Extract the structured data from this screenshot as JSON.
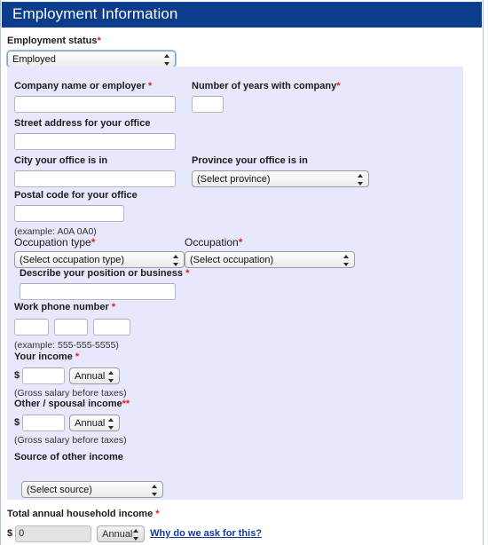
{
  "header": {
    "title": "Employment Information",
    "bar_color": "#0b3d8c"
  },
  "theme": {
    "panel_color": "#e7e8fb",
    "required_marker_color": "#e32119",
    "link_color": "#12399b"
  },
  "employment_status": {
    "label": "Employment status",
    "required_marker": "*",
    "selected": "Employed"
  },
  "fields": {
    "company_name": {
      "label": "Company name or employer",
      "required_marker": "*",
      "value": ""
    },
    "years_with_company": {
      "label": "Number of years with company",
      "required_marker": "*",
      "value": ""
    },
    "street_address": {
      "label": "Street address for your office",
      "value": ""
    },
    "city": {
      "label": "City your office is in",
      "value": ""
    },
    "province": {
      "label": "Province your office is in",
      "selected": "(Select province)"
    },
    "postal_code": {
      "label": "Postal code for your office",
      "value": "",
      "hint": "(example: A0A 0A0)"
    },
    "occupation_type": {
      "label": "Occupation type",
      "required_marker": "*",
      "selected": "(Select occupation type)"
    },
    "occupation": {
      "label": "Occupation",
      "required_marker": "*",
      "selected": "(Select occupation)"
    },
    "describe_position": {
      "label": "Describe your position or business",
      "required_marker": "*",
      "value": ""
    },
    "work_phone": {
      "label": "Work phone number",
      "required_marker": "*",
      "part1": "",
      "part2": "",
      "part3": "",
      "hint": "(example: 555-555-5555)"
    },
    "your_income": {
      "label": "Your income",
      "required_marker": "*",
      "currency_symbol": "$",
      "value": "",
      "frequency": "Annual",
      "hint": "(Gross salary before taxes)"
    },
    "other_income": {
      "label": "Other / spousal income",
      "required_marker": "**",
      "currency_symbol": "$",
      "value": "",
      "frequency": "Annual",
      "hint": "(Gross salary before taxes)"
    },
    "source_of_other_income": {
      "label": "Source of other income",
      "selected": "(Select source)"
    },
    "total_household_income": {
      "label": "Total annual household income",
      "required_marker": "*",
      "currency_symbol": "$",
      "value": "0",
      "frequency": "Annual",
      "link_text": "Why do we ask for this?"
    }
  }
}
